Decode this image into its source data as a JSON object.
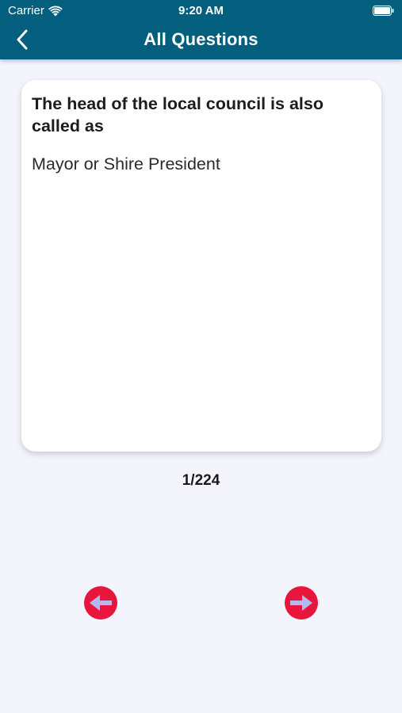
{
  "status_bar": {
    "carrier": "Carrier",
    "time": "9:20 AM"
  },
  "header": {
    "title": "All Questions",
    "background_color": "#045f7e"
  },
  "card": {
    "question": "The head of the local council is also called as",
    "answer": "Mayor or Shire President"
  },
  "pager": {
    "counter": "1/224",
    "accent_color": "#e8153d",
    "prev_icon": "arrow-left-icon",
    "next_icon": "arrow-right-icon"
  }
}
